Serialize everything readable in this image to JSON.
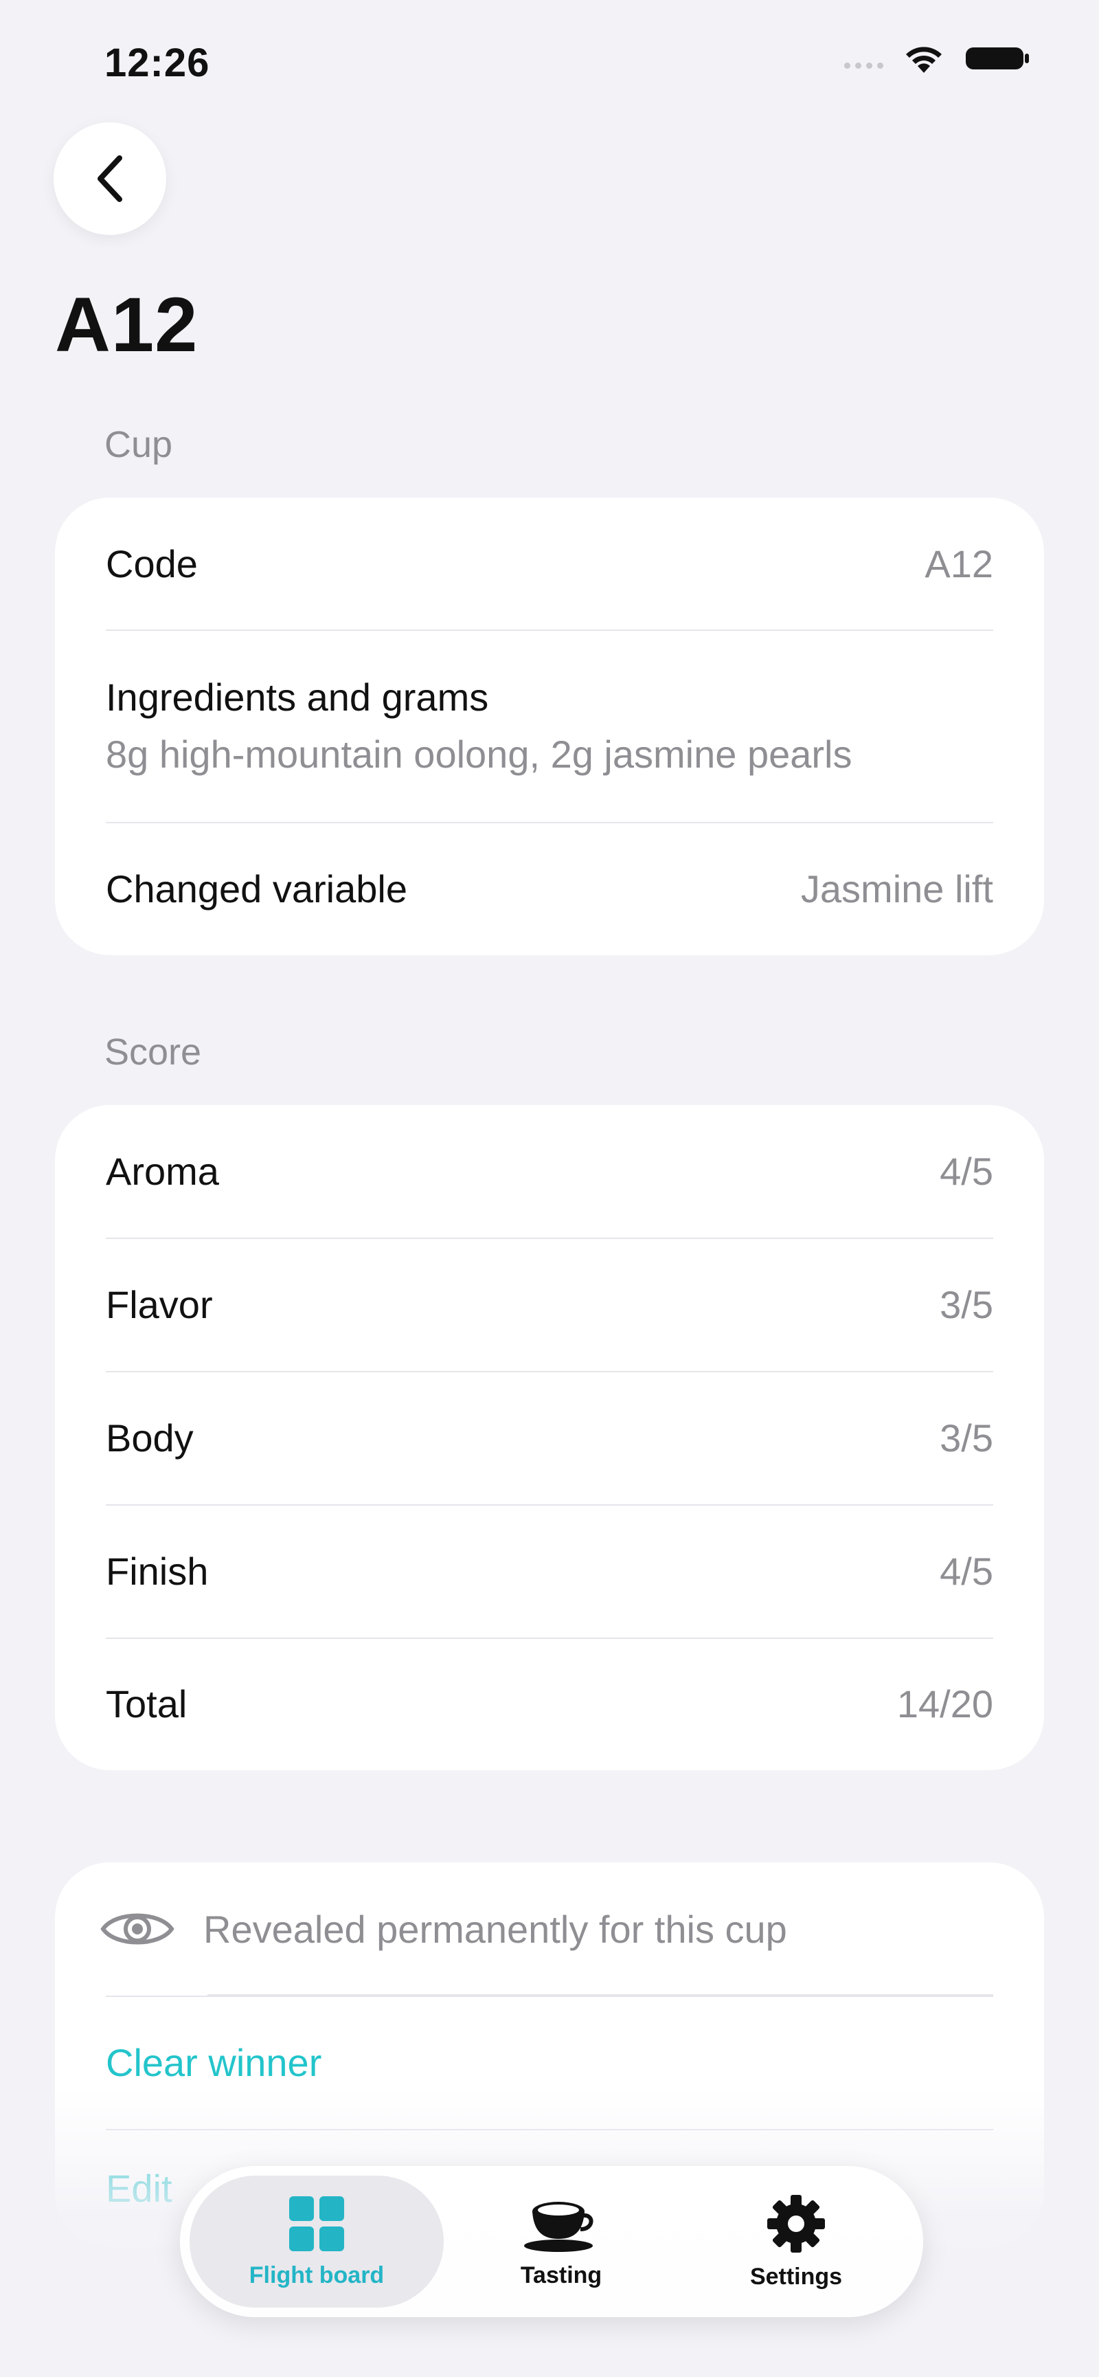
{
  "status_bar": {
    "time": "12:26"
  },
  "page": {
    "title": "A12"
  },
  "cup_section": {
    "header": "Cup",
    "code_label": "Code",
    "code_value": "A12",
    "ingredients_label": "Ingredients and grams",
    "ingredients_value": "8g high-mountain oolong, 2g jasmine pearls",
    "changed_label": "Changed variable",
    "changed_value": "Jasmine lift"
  },
  "score_section": {
    "header": "Score",
    "rows": [
      {
        "label": "Aroma",
        "value": "4/5"
      },
      {
        "label": "Flavor",
        "value": "3/5"
      },
      {
        "label": "Body",
        "value": "3/5"
      },
      {
        "label": "Finish",
        "value": "4/5"
      },
      {
        "label": "Total",
        "value": "14/20"
      }
    ]
  },
  "actions": {
    "revealed_text": "Revealed permanently for this cup",
    "clear_winner": "Clear winner",
    "edit_label": "Edit"
  },
  "tab_bar": {
    "tabs": [
      {
        "label": "Flight board",
        "icon": "grid-icon",
        "active": true
      },
      {
        "label": "Tasting",
        "icon": "teacup-icon",
        "active": false
      },
      {
        "label": "Settings",
        "icon": "gear-icon",
        "active": false
      }
    ]
  },
  "colors": {
    "accent": "#23C4CB",
    "background": "#F2F2F7"
  }
}
